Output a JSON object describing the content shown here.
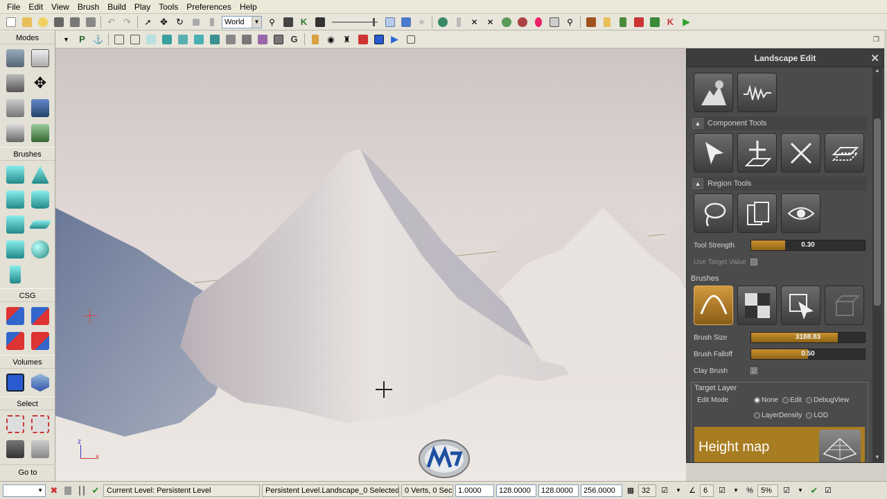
{
  "menu": [
    "File",
    "Edit",
    "View",
    "Brush",
    "Build",
    "Play",
    "Tools",
    "Preferences",
    "Help"
  ],
  "toolbar": {
    "coord_system": "World"
  },
  "toolbar2": {
    "letters": [
      "P",
      "G"
    ]
  },
  "modes": {
    "modes_label": "Modes",
    "brushes_label": "Brushes",
    "csg_label": "CSG",
    "volumes_label": "Volumes",
    "select_label": "Select",
    "goto_label": "Go to"
  },
  "panel": {
    "title": "Landscape Edit",
    "component_tools_label": "Component Tools",
    "region_tools_label": "Region Tools",
    "tool_strength_label": "Tool Strength",
    "tool_strength_value": "0.30",
    "tool_strength_fraction": 0.3,
    "use_target_value_label": "Use Target Value",
    "brushes_label": "Brushes",
    "brush_size_label": "Brush Size",
    "brush_size_value": "3188.83",
    "brush_size_fraction": 0.76,
    "brush_falloff_label": "Brush Falloff",
    "brush_falloff_value": "0.50",
    "brush_falloff_fraction": 0.5,
    "clay_brush_label": "Clay Brush",
    "clay_brush_checked": "☑",
    "target_layer_label": "Target Layer",
    "edit_mode_label": "Edit Mode",
    "edit_mode_options": [
      "None",
      "Edit",
      "DebugView",
      "LayerDensity",
      "LOD"
    ],
    "edit_mode_selected": "None",
    "heightmap_label": "Height map"
  },
  "statusbar": {
    "current_level": "Current Level:  Persistent Level",
    "selection_info": "Persistent Level.Landscape_0 Selected",
    "verts_info": "0 Verts, 0 Sec",
    "field_1": "1.0000",
    "field_2": "128.0000",
    "field_3": "128.0000",
    "field_4": "256.0000",
    "grid_value": "32",
    "angle_value": "6",
    "percent_value": "5%"
  },
  "colors": {
    "panel_bg": "#4b4b4b",
    "accent_orange": "#c9922e",
    "viewport_sky": "#e0d8d6"
  }
}
